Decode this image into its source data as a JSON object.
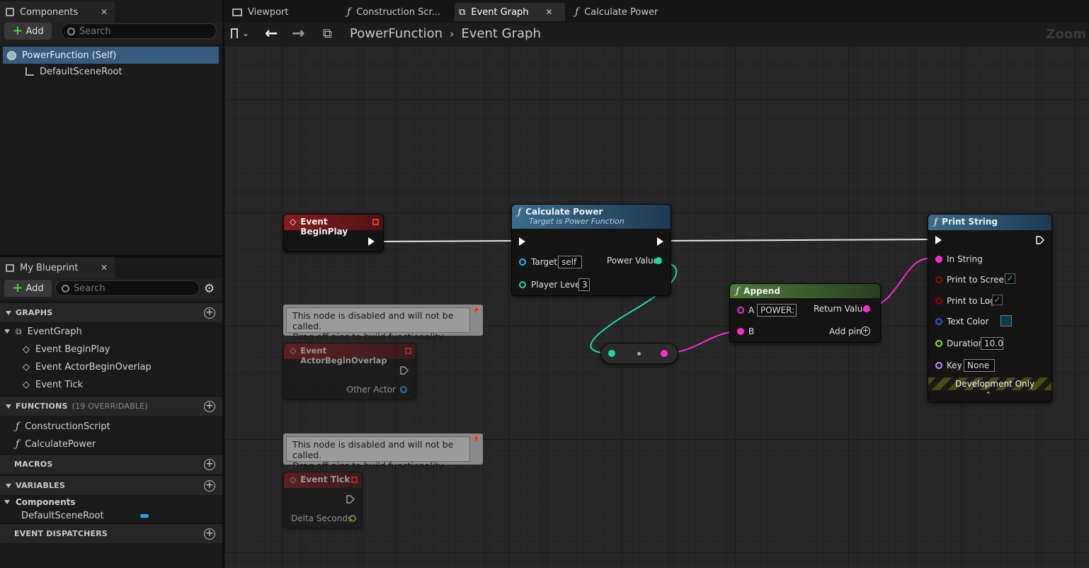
{
  "components_panel": {
    "title": "Components",
    "add_label": "Add",
    "search_placeholder": "Search",
    "tree": [
      {
        "label": "PowerFunction (Self)",
        "selected": true
      },
      {
        "label": "DefaultSceneRoot",
        "selected": false
      }
    ]
  },
  "blueprint_panel": {
    "title": "My Blueprint",
    "add_label": "Add",
    "search_placeholder": "Search",
    "graphs_header": "GRAPHS",
    "graphs": {
      "root": "EventGraph",
      "events": [
        "Event BeginPlay",
        "Event ActorBeginOverlap",
        "Event Tick"
      ]
    },
    "functions_header": "FUNCTIONS",
    "functions_overridable": "(19 OVERRIDABLE)",
    "functions": [
      "ConstructionScript",
      "CalculatePower"
    ],
    "macros_header": "MACROS",
    "variables_header": "VARIABLES",
    "variables_category": "Components",
    "variables": [
      "DefaultSceneRoot"
    ],
    "dispatchers_header": "EVENT DISPATCHERS"
  },
  "tabs": [
    {
      "label": "Viewport",
      "icon": "viewport-icon",
      "active": false
    },
    {
      "label": "Construction Scr...",
      "icon": "function-icon",
      "active": false
    },
    {
      "label": "Event Graph",
      "icon": "graph-icon",
      "active": true
    },
    {
      "label": "Calculate Power",
      "icon": "function-icon",
      "active": false
    }
  ],
  "breadcrumb": {
    "root": "PowerFunction",
    "current": "Event Graph",
    "zoom_label": "Zoom"
  },
  "nodes": {
    "begin_play": {
      "title": "Event BeginPlay"
    },
    "calculate_power": {
      "title": "Calculate Power",
      "subtitle": "Target is Power Function",
      "target_label": "Target",
      "target_value": "self",
      "player_level_label": "Player Level",
      "player_level_value": "3",
      "power_value_label": "Power Value"
    },
    "append": {
      "title": "Append",
      "a_label": "A",
      "a_value": "POWER:",
      "b_label": "B",
      "return_label": "Return Value",
      "add_pin_label": "Add pin"
    },
    "print_string": {
      "title": "Print String",
      "in_string": "In String",
      "print_to_screen": "Print to Screen",
      "print_to_log": "Print to Log",
      "text_color": "Text Color",
      "duration": "Duration",
      "duration_value": "10.0",
      "key": "Key",
      "key_value": "None",
      "dev_only": "Development Only",
      "print_to_screen_checked": true,
      "print_to_log_checked": true
    },
    "comment_text_1": "This node is disabled and will not be called.",
    "comment_text_2": "Drag off pins to build functionality.",
    "actor_overlap": {
      "title": "Event ActorBeginOverlap",
      "pin": "Other Actor"
    },
    "tick": {
      "title": "Event Tick",
      "pin": "Delta Seconds"
    }
  },
  "colors": {
    "event_header": "#8a1c1c",
    "function_header": "#3a6c8e",
    "string_function_header": "#4d7a3a",
    "exec": "#ffffff",
    "string_pin": "#ff2bd0",
    "int_pin": "#1fd6a8",
    "object_pin": "#3ab0f0",
    "bool_pin": "#9b0000",
    "float_pin": "#8ae04a",
    "name_pin": "#c68cff",
    "selection": "#375a7f"
  }
}
